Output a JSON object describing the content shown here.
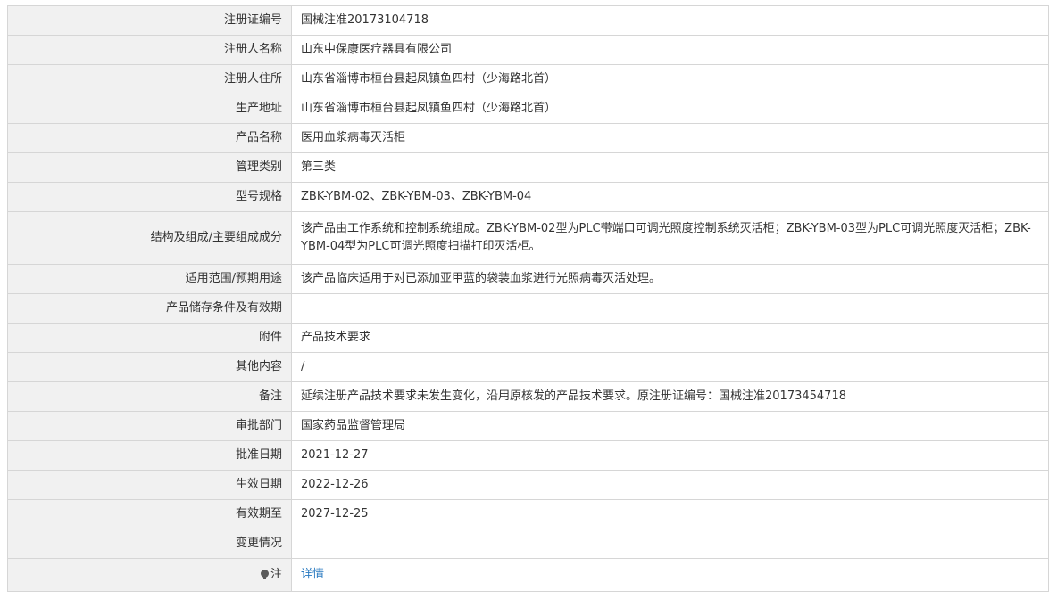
{
  "rows": [
    {
      "label": "注册证编号",
      "value": "国械注准20173104718"
    },
    {
      "label": "注册人名称",
      "value": "山东中保康医疗器具有限公司"
    },
    {
      "label": "注册人住所",
      "value": "山东省淄博市桓台县起凤镇鱼四村（少海路北首）"
    },
    {
      "label": "生产地址",
      "value": "山东省淄博市桓台县起凤镇鱼四村（少海路北首）"
    },
    {
      "label": "产品名称",
      "value": "医用血浆病毒灭活柜"
    },
    {
      "label": "管理类别",
      "value": "第三类"
    },
    {
      "label": "型号规格",
      "value": "ZBK-YBM-02、ZBK-YBM-03、ZBK-YBM-04"
    },
    {
      "label": "结构及组成/主要组成成分",
      "value": "该产品由工作系统和控制系统组成。ZBK-YBM-02型为PLC带端口可调光照度控制系统灭活柜；ZBK-YBM-03型为PLC可调光照度灭活柜；ZBK-YBM-04型为PLC可调光照度扫描打印灭活柜。"
    },
    {
      "label": "适用范围/预期用途",
      "value": "该产品临床适用于对已添加亚甲蓝的袋装血浆进行光照病毒灭活处理。"
    },
    {
      "label": "产品储存条件及有效期",
      "value": ""
    },
    {
      "label": "附件",
      "value": "产品技术要求"
    },
    {
      "label": "其他内容",
      "value": "/"
    },
    {
      "label": "备注",
      "value": "延续注册产品技术要求未发生变化，沿用原核发的产品技术要求。原注册证编号：国械注准20173454718"
    },
    {
      "label": "审批部门",
      "value": "国家药品监督管理局"
    },
    {
      "label": "批准日期",
      "value": "2021-12-27"
    },
    {
      "label": "生效日期",
      "value": "2022-12-26"
    },
    {
      "label": "有效期至",
      "value": "2027-12-25"
    },
    {
      "label": "变更情况",
      "value": ""
    }
  ],
  "note": {
    "icon": "lightbulb-icon",
    "label": "注",
    "link_text": "详情"
  },
  "colors": {
    "label_bg": "#f1f1f1",
    "border": "#d6d6d6",
    "link": "#2a7ac0"
  }
}
